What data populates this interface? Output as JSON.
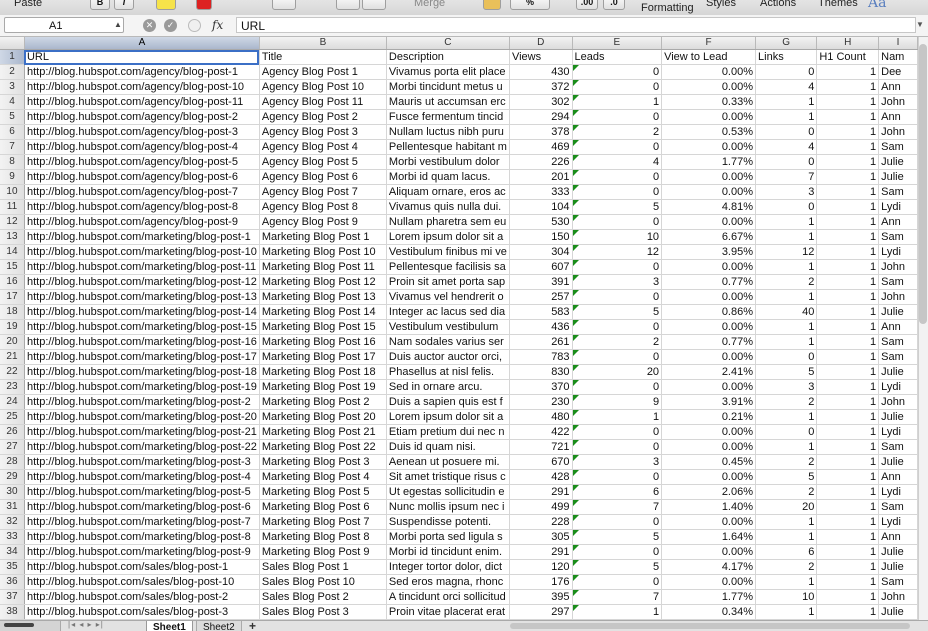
{
  "ribbon": {
    "paste": "Paste",
    "bold": "B",
    "italic": "I",
    "underline": "U",
    "merge": "Merge",
    "number_format": "%",
    "decimals_a": ".00",
    "decimals_b": ".0",
    "formatting": "Formatting",
    "styles": "Styles",
    "actions": "Actions",
    "themes": "Themes",
    "themes_icon": "Aa"
  },
  "formula_bar": {
    "cell_ref": "A1",
    "fx": "fx",
    "content": "URL",
    "cancel_icon": "✕",
    "confirm_icon": "✓"
  },
  "grid": {
    "columns": [
      "A",
      "B",
      "C",
      "D",
      "E",
      "F",
      "G",
      "H",
      "I"
    ],
    "header": [
      "URL",
      "Title",
      "Description",
      "Views",
      "Leads",
      "View to Lead",
      "Links",
      "H1 Count",
      "Nam"
    ],
    "rows": [
      [
        "http://blog.hubspot.com/agency/blog-post-1",
        "Agency Blog Post 1",
        "Vivamus porta elit place",
        "430",
        "0",
        "0.00%",
        "0",
        "1",
        "Dee"
      ],
      [
        "http://blog.hubspot.com/agency/blog-post-10",
        "Agency Blog Post 10",
        "Morbi tincidunt metus u",
        "372",
        "0",
        "0.00%",
        "4",
        "1",
        "Ann"
      ],
      [
        "http://blog.hubspot.com/agency/blog-post-11",
        "Agency Blog Post 11",
        "Mauris ut accumsan erc",
        "302",
        "1",
        "0.33%",
        "1",
        "1",
        "John"
      ],
      [
        "http://blog.hubspot.com/agency/blog-post-2",
        "Agency Blog Post 2",
        "Fusce fermentum tincid",
        "294",
        "0",
        "0.00%",
        "1",
        "1",
        "Ann"
      ],
      [
        "http://blog.hubspot.com/agency/blog-post-3",
        "Agency Blog Post 3",
        "Nullam luctus nibh puru",
        "378",
        "2",
        "0.53%",
        "0",
        "1",
        "John"
      ],
      [
        "http://blog.hubspot.com/agency/blog-post-4",
        "Agency Blog Post 4",
        "Pellentesque habitant m",
        "469",
        "0",
        "0.00%",
        "4",
        "1",
        "Sam"
      ],
      [
        "http://blog.hubspot.com/agency/blog-post-5",
        "Agency Blog Post 5",
        "Morbi vestibulum dolor",
        "226",
        "4",
        "1.77%",
        "0",
        "1",
        "Julie"
      ],
      [
        "http://blog.hubspot.com/agency/blog-post-6",
        "Agency Blog Post 6",
        "Morbi id quam lacus.",
        "201",
        "0",
        "0.00%",
        "7",
        "1",
        "Julie"
      ],
      [
        "http://blog.hubspot.com/agency/blog-post-7",
        "Agency Blog Post 7",
        "Aliquam ornare, eros ac",
        "333",
        "0",
        "0.00%",
        "3",
        "1",
        "Sam"
      ],
      [
        "http://blog.hubspot.com/agency/blog-post-8",
        "Agency Blog Post 8",
        "Vivamus quis nulla dui.",
        "104",
        "5",
        "4.81%",
        "0",
        "1",
        "Lydi"
      ],
      [
        "http://blog.hubspot.com/agency/blog-post-9",
        "Agency Blog Post 9",
        "Nullam pharetra sem eu",
        "530",
        "0",
        "0.00%",
        "1",
        "1",
        "Ann"
      ],
      [
        "http://blog.hubspot.com/marketing/blog-post-1",
        "Marketing Blog Post 1",
        "Lorem ipsum dolor sit a",
        "150",
        "10",
        "6.67%",
        "1",
        "1",
        "Sam"
      ],
      [
        "http://blog.hubspot.com/marketing/blog-post-10",
        "Marketing Blog Post 10",
        "Vestibulum finibus mi ve",
        "304",
        "12",
        "3.95%",
        "12",
        "1",
        "Lydi"
      ],
      [
        "http://blog.hubspot.com/marketing/blog-post-11",
        "Marketing Blog Post 11",
        "Pellentesque facilisis sa",
        "607",
        "0",
        "0.00%",
        "1",
        "1",
        "John"
      ],
      [
        "http://blog.hubspot.com/marketing/blog-post-12",
        "Marketing Blog Post 12",
        "Proin sit amet porta sap",
        "391",
        "3",
        "0.77%",
        "2",
        "1",
        "Sam"
      ],
      [
        "http://blog.hubspot.com/marketing/blog-post-13",
        "Marketing Blog Post 13",
        "Vivamus vel hendrerit o",
        "257",
        "0",
        "0.00%",
        "1",
        "1",
        "John"
      ],
      [
        "http://blog.hubspot.com/marketing/blog-post-14",
        "Marketing Blog Post 14",
        "Integer ac lacus sed dia",
        "583",
        "5",
        "0.86%",
        "40",
        "1",
        "Julie"
      ],
      [
        "http://blog.hubspot.com/marketing/blog-post-15",
        "Marketing Blog Post 15",
        "Vestibulum vestibulum",
        "436",
        "0",
        "0.00%",
        "1",
        "1",
        "Ann"
      ],
      [
        "http://blog.hubspot.com/marketing/blog-post-16",
        "Marketing Blog Post 16",
        "Nam sodales varius ser",
        "261",
        "2",
        "0.77%",
        "1",
        "1",
        "Sam"
      ],
      [
        "http://blog.hubspot.com/marketing/blog-post-17",
        "Marketing Blog Post 17",
        "Duis auctor auctor orci,",
        "783",
        "0",
        "0.00%",
        "0",
        "1",
        "Sam"
      ],
      [
        "http://blog.hubspot.com/marketing/blog-post-18",
        "Marketing Blog Post 18",
        "Phasellus at nisl felis.",
        "830",
        "20",
        "2.41%",
        "5",
        "1",
        "Julie"
      ],
      [
        "http://blog.hubspot.com/marketing/blog-post-19",
        "Marketing Blog Post 19",
        "Sed in ornare arcu.",
        "370",
        "0",
        "0.00%",
        "3",
        "1",
        "Lydi"
      ],
      [
        "http://blog.hubspot.com/marketing/blog-post-2",
        "Marketing Blog Post 2",
        "Duis a sapien quis est f",
        "230",
        "9",
        "3.91%",
        "2",
        "1",
        "John"
      ],
      [
        "http://blog.hubspot.com/marketing/blog-post-20",
        "Marketing Blog Post 20",
        "Lorem ipsum dolor sit a",
        "480",
        "1",
        "0.21%",
        "1",
        "1",
        "Julie"
      ],
      [
        "http://blog.hubspot.com/marketing/blog-post-21",
        "Marketing Blog Post 21",
        "Etiam pretium dui nec n",
        "422",
        "0",
        "0.00%",
        "0",
        "1",
        "Lydi"
      ],
      [
        "http://blog.hubspot.com/marketing/blog-post-22",
        "Marketing Blog Post 22",
        "Duis id quam nisi.",
        "721",
        "0",
        "0.00%",
        "1",
        "1",
        "Sam"
      ],
      [
        "http://blog.hubspot.com/marketing/blog-post-3",
        "Marketing Blog Post 3",
        "Aenean ut posuere mi.",
        "670",
        "3",
        "0.45%",
        "2",
        "1",
        "Julie"
      ],
      [
        "http://blog.hubspot.com/marketing/blog-post-4",
        "Marketing Blog Post 4",
        "Sit amet tristique risus c",
        "428",
        "0",
        "0.00%",
        "5",
        "1",
        "Ann"
      ],
      [
        "http://blog.hubspot.com/marketing/blog-post-5",
        "Marketing Blog Post 5",
        "Ut egestas sollicitudin e",
        "291",
        "6",
        "2.06%",
        "2",
        "1",
        "Lydi"
      ],
      [
        "http://blog.hubspot.com/marketing/blog-post-6",
        "Marketing Blog Post 6",
        "Nunc mollis ipsum nec i",
        "499",
        "7",
        "1.40%",
        "20",
        "1",
        "Sam"
      ],
      [
        "http://blog.hubspot.com/marketing/blog-post-7",
        "Marketing Blog Post 7",
        "Suspendisse potenti.",
        "228",
        "0",
        "0.00%",
        "1",
        "1",
        "Lydi"
      ],
      [
        "http://blog.hubspot.com/marketing/blog-post-8",
        "Marketing Blog Post 8",
        "Morbi porta sed ligula s",
        "305",
        "5",
        "1.64%",
        "1",
        "1",
        "Ann"
      ],
      [
        "http://blog.hubspot.com/marketing/blog-post-9",
        "Marketing Blog Post 9",
        "Morbi id tincidunt enim.",
        "291",
        "0",
        "0.00%",
        "6",
        "1",
        "Julie"
      ],
      [
        "http://blog.hubspot.com/sales/blog-post-1",
        "Sales Blog Post 1",
        "Integer tortor dolor, dict",
        "120",
        "5",
        "4.17%",
        "2",
        "1",
        "Julie"
      ],
      [
        "http://blog.hubspot.com/sales/blog-post-10",
        "Sales Blog Post 10",
        "Sed eros magna, rhonc",
        "176",
        "0",
        "0.00%",
        "1",
        "1",
        "Sam"
      ],
      [
        "http://blog.hubspot.com/sales/blog-post-2",
        "Sales Blog Post 2",
        "A tincidunt orci sollicitud",
        "395",
        "7",
        "1.77%",
        "10",
        "1",
        "John"
      ],
      [
        "http://blog.hubspot.com/sales/blog-post-3",
        "Sales Blog Post 3",
        "Proin vitae placerat erat",
        "297",
        "1",
        "0.34%",
        "1",
        "1",
        "Julie"
      ]
    ]
  },
  "sheets": [
    "Sheet1",
    "Sheet2"
  ],
  "add_sheet": "+",
  "nav_arrows": "|◂ ◂ ▸ ▸|",
  "colors": {
    "selection": "#3b6fc6",
    "error_indicator": "#1a8d1a"
  }
}
